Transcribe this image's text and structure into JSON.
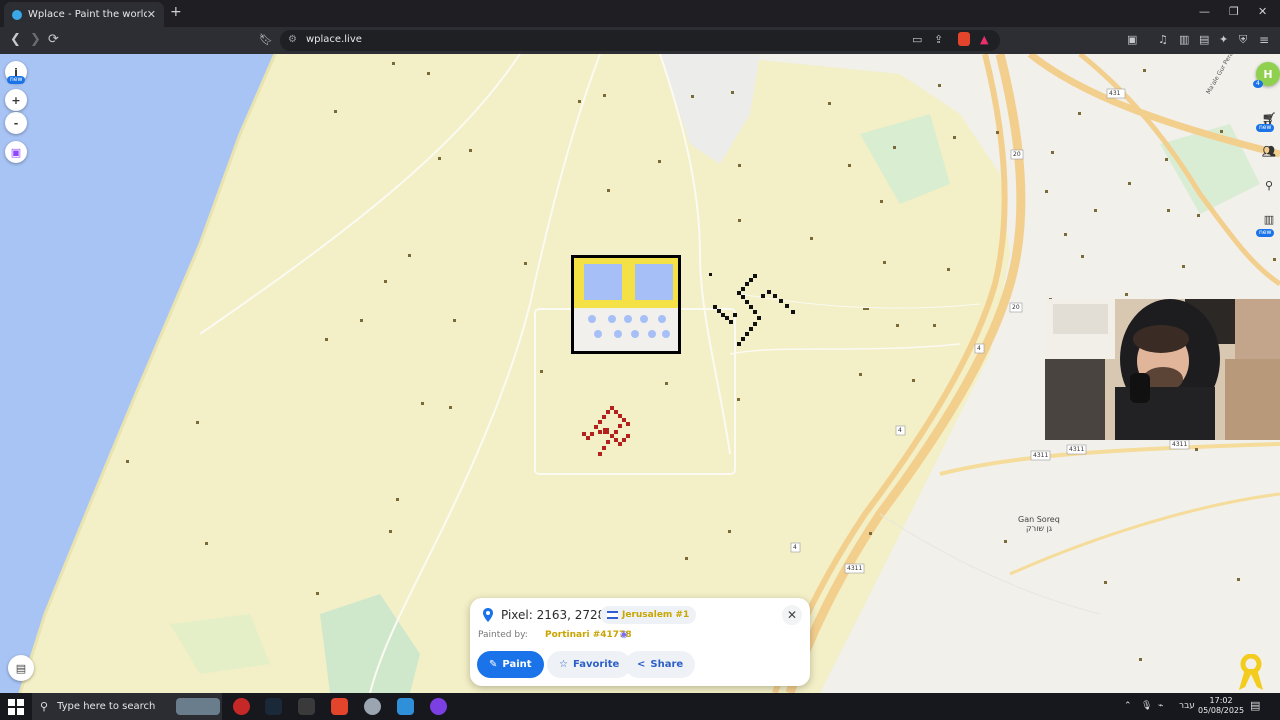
{
  "browser": {
    "tab_title": "Wplace - Paint the world",
    "tab_close": "✕",
    "new_tab": "+",
    "url": "wplace.live",
    "min": "—",
    "restore": "❐",
    "close": "✕"
  },
  "map": {
    "road_labels": [
      "431",
      "20",
      "20",
      "4",
      "4",
      "4",
      "4311",
      "4311",
      "4311",
      "4311",
      "Gan Soreq",
      "גן שורק",
      "Ma'ale Gur Perat"
    ],
    "left_new_badge": "new",
    "right_new_badges": [
      "new",
      "new",
      "new"
    ],
    "zoom_in": "+",
    "zoom_out": "-",
    "info_icon": "i",
    "right_count_badge": "4"
  },
  "panel": {
    "pixel_label": "Pixel: 2163, 2728",
    "region": "Jerusalem #1",
    "painted_by_label": "Painted by:",
    "painter": "Portinari #41778",
    "paint_label": "Paint",
    "favorite_label": "Favorite",
    "share_label": "Share",
    "close": "✕"
  },
  "taskbar": {
    "search_placeholder": "Type here to search",
    "lang": "עבר",
    "time": "17:02",
    "date": "05/08/2025"
  },
  "colors": {
    "accent": "#1a73e8",
    "map_land": "#f3efc6",
    "sea": "#a8c4f5",
    "highway": "#f3cf8e"
  }
}
